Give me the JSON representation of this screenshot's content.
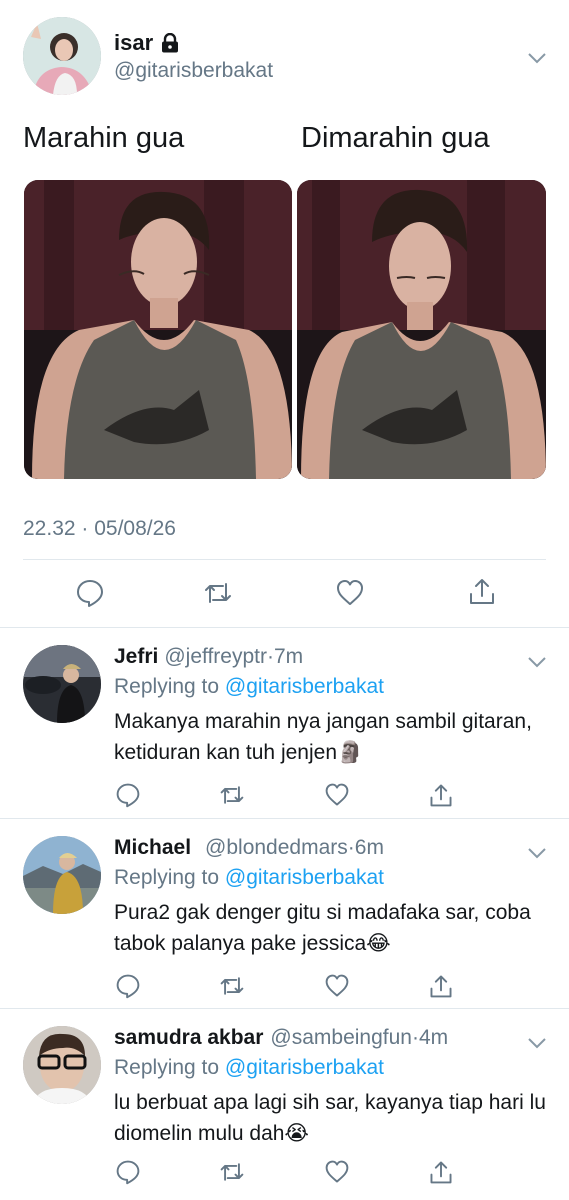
{
  "main_tweet": {
    "name": "isar",
    "handle": "@gitarisberbakat",
    "caption_left": "Marahin gua",
    "caption_right": "Dimarahin gua",
    "timestamp": "22.32 · 05/08/26",
    "icons": [
      "lock-icon",
      "chevron-down-icon",
      "reply-icon",
      "retweet-icon",
      "like-icon",
      "share-icon"
    ]
  },
  "replies": [
    {
      "name": "Jefri",
      "handle": "@jeffreyptr",
      "time": "7m",
      "replying_prefix": "Replying to",
      "replying_to": "@gitarisberbakat",
      "text": "Makanya marahin nya jangan sambil gitaran, ketiduran kan tuh jenjen🗿"
    },
    {
      "name": "Michael",
      "handle": "@blondedmars",
      "time": "6m",
      "replying_prefix": "Replying to",
      "replying_to": "@gitarisberbakat",
      "text": "Pura2 gak denger gitu si madafaka sar, coba tabok palanya pake jessica😂"
    },
    {
      "name": "samudra akbar",
      "handle": "@sambeingfun",
      "time": "4m",
      "replying_prefix": "Replying to",
      "replying_to": "@gitarisberbakat",
      "text": "lu berbuat apa lagi sih sar, kayanya tiap hari lu diomelin mulu dah😭"
    }
  ],
  "colors": {
    "text": "#14171a",
    "secondary": "#657786",
    "link": "#1da1f2",
    "divider": "#e1e8ed"
  }
}
